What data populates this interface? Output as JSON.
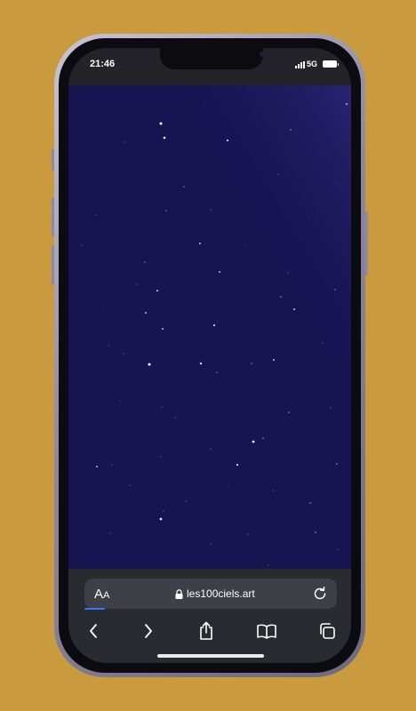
{
  "status_bar": {
    "time": "21:46",
    "network": "5G",
    "icons": [
      "signal-icon",
      "battery-icon"
    ]
  },
  "web_content": {
    "background_color": "#181452",
    "star_color": "#ffffff"
  },
  "toolbar": {
    "reader_label_large": "A",
    "reader_label_small": "A",
    "url": "les100ciels.art",
    "page_load_progress": 0.08,
    "buttons": [
      "back-icon",
      "forward-icon",
      "share-icon",
      "bookmarks-icon",
      "tabs-icon"
    ]
  },
  "colors": {
    "backdrop": "#c99a3e",
    "accent": "#2f7df6"
  }
}
